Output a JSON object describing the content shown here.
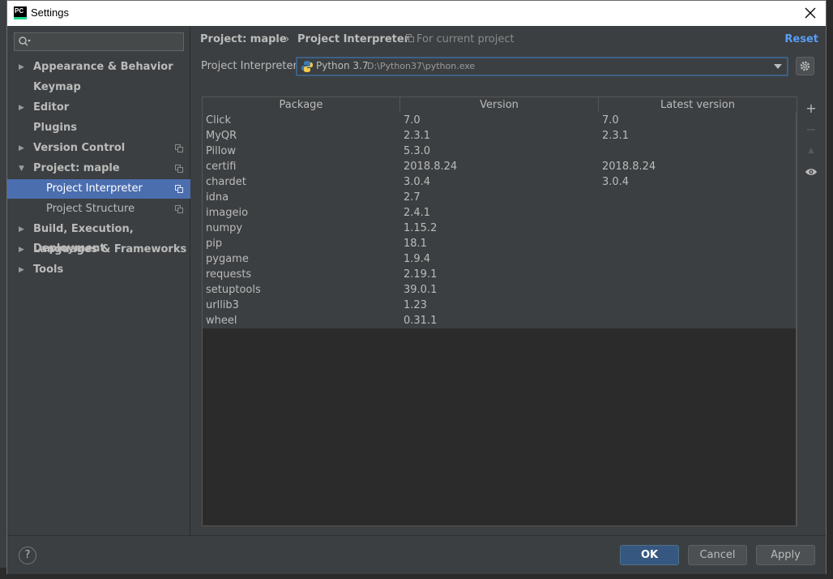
{
  "window": {
    "title": "Settings",
    "app_icon_text": "PC"
  },
  "search": {
    "placeholder": ""
  },
  "sidebar": {
    "items": [
      {
        "label": "Appearance & Behavior",
        "expandable": true,
        "expanded": false,
        "project_scope": false
      },
      {
        "label": "Keymap",
        "expandable": false,
        "project_scope": false
      },
      {
        "label": "Editor",
        "expandable": true,
        "expanded": false,
        "project_scope": false
      },
      {
        "label": "Plugins",
        "expandable": false,
        "project_scope": false
      },
      {
        "label": "Version Control",
        "expandable": true,
        "expanded": false,
        "project_scope": true
      },
      {
        "label": "Project: maple",
        "expandable": true,
        "expanded": true,
        "project_scope": true
      },
      {
        "label": "Project Interpreter",
        "child": true,
        "selected": true,
        "project_scope": true
      },
      {
        "label": "Project Structure",
        "child": true,
        "project_scope": true
      },
      {
        "label": "Build, Execution, Deployment",
        "expandable": true,
        "expanded": false,
        "project_scope": false
      },
      {
        "label": "Languages & Frameworks",
        "expandable": true,
        "expanded": false,
        "project_scope": false
      },
      {
        "label": "Tools",
        "expandable": true,
        "expanded": false,
        "project_scope": false
      }
    ]
  },
  "header": {
    "breadcrumb_parent": "Project: maple",
    "breadcrumb_separator": "›",
    "breadcrumb_current": "Project Interpreter",
    "scope_note": "For current project",
    "reset_label": "Reset"
  },
  "interpreter": {
    "label": "Project Interpreter:",
    "name": "Python 3.7",
    "path": "D:\\Python37\\python.exe"
  },
  "table": {
    "columns": [
      "Package",
      "Version",
      "Latest version"
    ],
    "rows": [
      [
        "Click",
        "7.0",
        "7.0"
      ],
      [
        "MyQR",
        "2.3.1",
        "2.3.1"
      ],
      [
        "Pillow",
        "5.3.0",
        ""
      ],
      [
        "certifi",
        "2018.8.24",
        "2018.8.24"
      ],
      [
        "chardet",
        "3.0.4",
        "3.0.4"
      ],
      [
        "idna",
        "2.7",
        ""
      ],
      [
        "imageio",
        "2.4.1",
        ""
      ],
      [
        "numpy",
        "1.15.2",
        ""
      ],
      [
        "pip",
        "18.1",
        ""
      ],
      [
        "pygame",
        "1.9.4",
        ""
      ],
      [
        "requests",
        "2.19.1",
        ""
      ],
      [
        "setuptools",
        "39.0.1",
        ""
      ],
      [
        "urllib3",
        "1.23",
        ""
      ],
      [
        "wheel",
        "0.31.1",
        ""
      ]
    ]
  },
  "tools": {
    "add": "+",
    "remove": "−",
    "upgrade": "▲"
  },
  "footer": {
    "help": "?",
    "ok": "OK",
    "cancel": "Cancel",
    "apply": "Apply"
  },
  "colors": {
    "selection": "#4b6eaf",
    "link": "#589df6",
    "primary_button": "#365880",
    "panel": "#3c3f41"
  }
}
